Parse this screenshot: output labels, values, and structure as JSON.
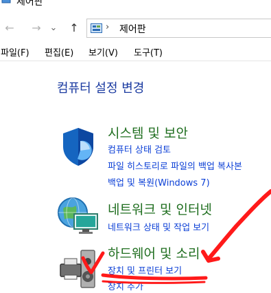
{
  "window": {
    "title": "제어판"
  },
  "nav": {
    "back": "←",
    "forward": "→",
    "dropdown": "⌄",
    "up": "↑"
  },
  "address": {
    "separator": "›",
    "path": "제어판"
  },
  "menu": [
    "파일(F)",
    "편집(E)",
    "보기(V)",
    "도구(T)"
  ],
  "main": {
    "heading": "컴퓨터 설정 변경",
    "categories": [
      {
        "title": "시스템 및 보안",
        "icon": "shield-icon",
        "links": [
          "컴퓨터 상태 검토",
          "파일 히스토리로 파일의 백업 복사본",
          "백업 및 복원(Windows 7)"
        ]
      },
      {
        "title": "네트워크 및 인터넷",
        "icon": "network-globe-icon",
        "links": [
          "네트워크 상태 및 작업 보기"
        ]
      },
      {
        "title": "하드웨어 및 소리",
        "icon": "printer-speaker-icon",
        "links": [
          "장치 및 프린터 보기",
          "장치 추가"
        ]
      }
    ]
  },
  "annotation": {
    "color": "#ff1a1a",
    "marks": [
      "check-mark",
      "arrow",
      "underline"
    ]
  }
}
